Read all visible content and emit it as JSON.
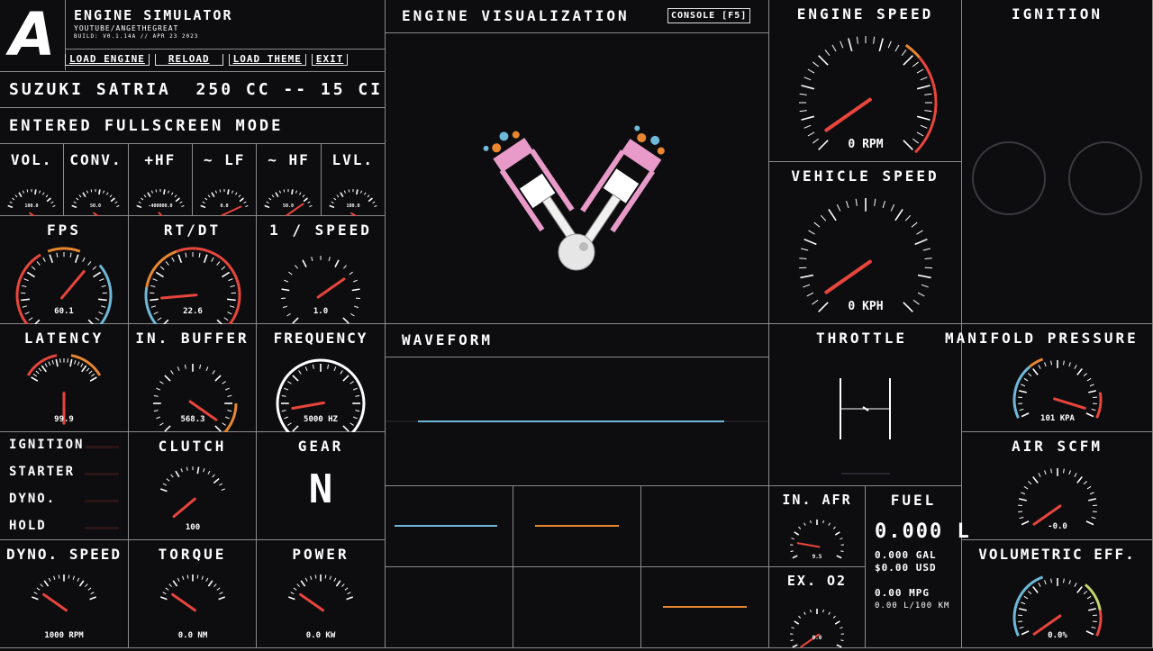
{
  "app": {
    "logo": "A",
    "title": "ENGINE SIMULATOR",
    "subtitle": "YOUTUBE/ANGETHEGREAT",
    "build": "BUILD: V0.1.14A // APR 23 2023"
  },
  "menu": {
    "load_engine": "LOAD ENGINE",
    "reload": "RELOAD",
    "load_theme": "LOAD THEME",
    "exit": "EXIT"
  },
  "engine_name": "SUZUKI SATRIA  250 CC -- 15 CI",
  "status_message": "ENTERED FULLSCREEN MODE",
  "mini_gauges": [
    {
      "label": "VOL.",
      "readout": "100.0"
    },
    {
      "label": "CONV.",
      "readout": "50.0"
    },
    {
      "label": "+HF",
      "readout": "-400000.0"
    },
    {
      "label": "~ LF",
      "readout": "0.0"
    },
    {
      "label": "~ HF",
      "readout": "50.0"
    },
    {
      "label": "LVL.",
      "readout": "100.0"
    }
  ],
  "gauges": {
    "fps": {
      "title": "FPS",
      "readout": "60.1"
    },
    "rtdt": {
      "title": "RT/DT",
      "readout": "22.6"
    },
    "speed_inv": {
      "title": "1 / SPEED",
      "readout": "1.0"
    },
    "latency": {
      "title": "LATENCY",
      "readout": "99.9"
    },
    "in_buffer": {
      "title": "IN. BUFFER",
      "readout": "568.3"
    },
    "frequency": {
      "title": "FREQUENCY",
      "readout": "5000 HZ"
    },
    "clutch": {
      "title": "CLUTCH",
      "readout": "100"
    },
    "dyno_speed": {
      "title": "DYNO. SPEED",
      "readout": "1000 RPM"
    },
    "torque": {
      "title": "TORQUE",
      "readout": "0.0 NM"
    },
    "power": {
      "title": "POWER",
      "readout": "0.0 KW"
    },
    "engine_speed": {
      "title": "ENGINE SPEED",
      "readout": "0 RPM"
    },
    "vehicle_speed": {
      "title": "VEHICLE SPEED",
      "readout": "0 KPH"
    },
    "manifold": {
      "title": "MANIFOLD PRESSURE",
      "readout": "101 KPA"
    },
    "air_scfm": {
      "title": "AIR SCFM",
      "readout": "-0.0"
    },
    "in_afr": {
      "title": "IN. AFR",
      "readout": "9.5"
    },
    "ex_o2": {
      "title": "EX. O2",
      "readout": "0.0"
    },
    "vol_eff": {
      "title": "VOLUMETRIC EFF.",
      "readout": "0.0%"
    }
  },
  "indicators": [
    "IGNITION",
    "STARTER",
    "DYNO.",
    "HOLD"
  ],
  "gear": {
    "title": "GEAR",
    "value": "N"
  },
  "visualization": {
    "title": "ENGINE VISUALIZATION",
    "console_button": "CONSOLE [F5]"
  },
  "waveform": {
    "title": "WAVEFORM"
  },
  "throttle": {
    "title": "THROTTLE"
  },
  "ignition": {
    "title": "IGNITION"
  },
  "fuel": {
    "title": "FUEL",
    "liters": "0.000 L",
    "gallons": "0.000 GAL",
    "usd": "$0.00 USD",
    "mpg": "0.00 MPG",
    "l100": "0.00 L/100 KM"
  },
  "colors": {
    "background": "#0d0d10",
    "needle": "#e8453c",
    "orange": "#e8872f",
    "blue": "#6fb8d8",
    "green": "#c6d36a",
    "pink": "#e89ac8"
  }
}
